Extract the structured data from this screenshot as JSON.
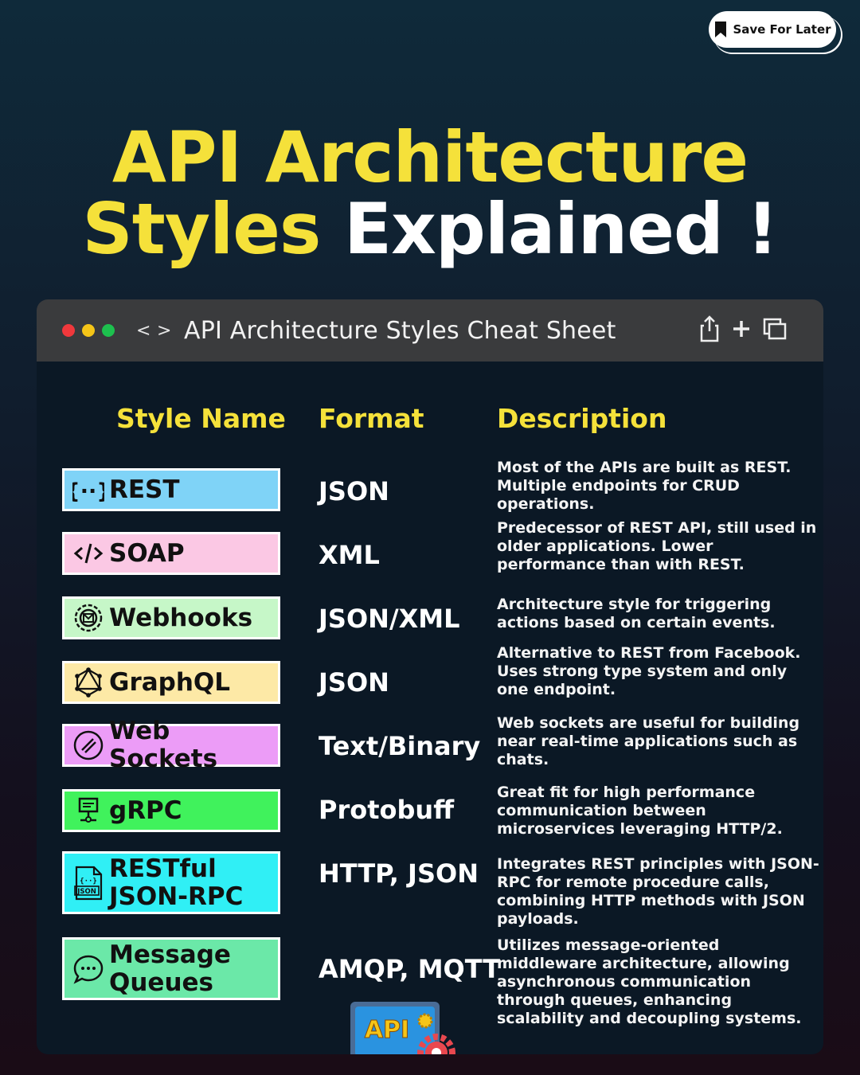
{
  "save_button": {
    "label": "Save For Later",
    "icon": "bookmark-icon"
  },
  "title": {
    "line1": "API Architecture",
    "line2_highlight": "Styles",
    "line2_rest": "Explained !"
  },
  "window": {
    "title": "API Architecture Styles Cheat Sheet",
    "back": "<",
    "forward": ">"
  },
  "table": {
    "headers": {
      "name": "Style Name",
      "format": "Format",
      "description": "Description"
    },
    "rows": [
      {
        "name": "REST",
        "format": "JSON",
        "icon": "curly-braces-icon",
        "color": "#7fd3f7",
        "description": "Most of the APIs are built as REST. Multiple endpoints for CRUD operations."
      },
      {
        "name": "SOAP",
        "format": "XML",
        "icon": "code-tag-icon",
        "color": "#fbc8e4",
        "description": "Predecessor of REST API, still used in older applications. Lower performance than with REST."
      },
      {
        "name": "Webhooks",
        "format": "JSON/XML",
        "icon": "webhook-gear-icon",
        "color": "#c6f7c8",
        "description": "Architecture style for triggering actions based on certain events."
      },
      {
        "name": "GraphQL",
        "format": "JSON",
        "icon": "graphql-icon",
        "color": "#fde9a6",
        "description": "Alternative to REST from Facebook. Uses strong type system and only one endpoint."
      },
      {
        "name": "Web Sockets",
        "format": "Text/Binary",
        "icon": "websocket-icon",
        "color": "#ec9cf7",
        "description": "Web sockets are useful for building near real-time applications such as chats."
      },
      {
        "name": "gRPC",
        "format": "Protobuff",
        "icon": "grpc-icon",
        "color": "#40f25c",
        "description": "Great fit for high performance communication between microservices leveraging HTTP/2."
      },
      {
        "name": "RESTful JSON-RPC",
        "format": "HTTP, JSON",
        "icon": "json-file-icon",
        "color": "#30eff5",
        "description": "Integrates REST principles with JSON-RPC for remote procedure calls, combining HTTP methods with JSON payloads."
      },
      {
        "name": "Message Queues",
        "format": "AMQP, MQTT",
        "icon": "chat-bubble-icon",
        "color": "#6be8a8",
        "description": "Utilizes message-oriented middleware architecture, allowing asynchronous communication through queues, enhancing scalability and decoupling systems."
      }
    ]
  },
  "illustration": {
    "label": "API",
    "icon": "api-monitor-gear-icon"
  }
}
